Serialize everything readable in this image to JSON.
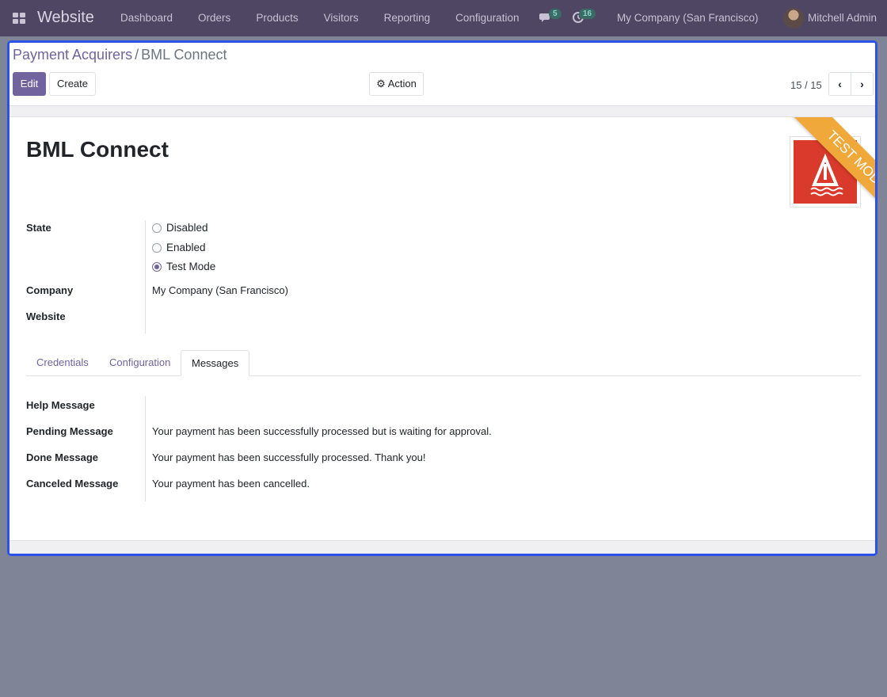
{
  "navbar": {
    "brand": "Website",
    "menu": [
      {
        "label": "Dashboard"
      },
      {
        "label": "Orders"
      },
      {
        "label": "Products"
      },
      {
        "label": "Visitors"
      },
      {
        "label": "Reporting"
      },
      {
        "label": "Configuration"
      }
    ],
    "messages_count": "5",
    "activities_count": "16",
    "company": "My Company (San Francisco)",
    "user": "Mitchell Admin",
    "icons": {
      "apps": "apps-grid-icon",
      "messages": "chat-icon",
      "activities": "clock-icon"
    }
  },
  "breadcrumb": {
    "parent": "Payment Acquirers",
    "separator": "/",
    "current": "BML Connect"
  },
  "toolbar": {
    "edit_label": "Edit",
    "create_label": "Create",
    "action_label": "Action",
    "pager": "15 / 15"
  },
  "record": {
    "title": "BML Connect",
    "ribbon": "TEST MODE",
    "state_label": "State",
    "state_options": [
      {
        "label": "Disabled",
        "checked": false
      },
      {
        "label": "Enabled",
        "checked": false
      },
      {
        "label": "Test Mode",
        "checked": true
      }
    ],
    "company_label": "Company",
    "company_value": "My Company (San Francisco)",
    "website_label": "Website",
    "website_value": ""
  },
  "tabs": [
    {
      "label": "Credentials",
      "active": false
    },
    {
      "label": "Configuration",
      "active": false
    },
    {
      "label": "Messages",
      "active": true
    }
  ],
  "messages": {
    "help_label": "Help Message",
    "help_value": "",
    "pending_label": "Pending Message",
    "pending_value": "Your payment has been successfully processed but is waiting for approval.",
    "done_label": "Done Message",
    "done_value": "Your payment has been successfully processed. Thank you!",
    "canceled_label": "Canceled Message",
    "canceled_value": "Your payment has been cancelled."
  },
  "colors": {
    "navbar": "#4f4664",
    "accent": "#71639e",
    "ribbon": "#f0a83a",
    "highlight_border": "#2a52e8"
  }
}
